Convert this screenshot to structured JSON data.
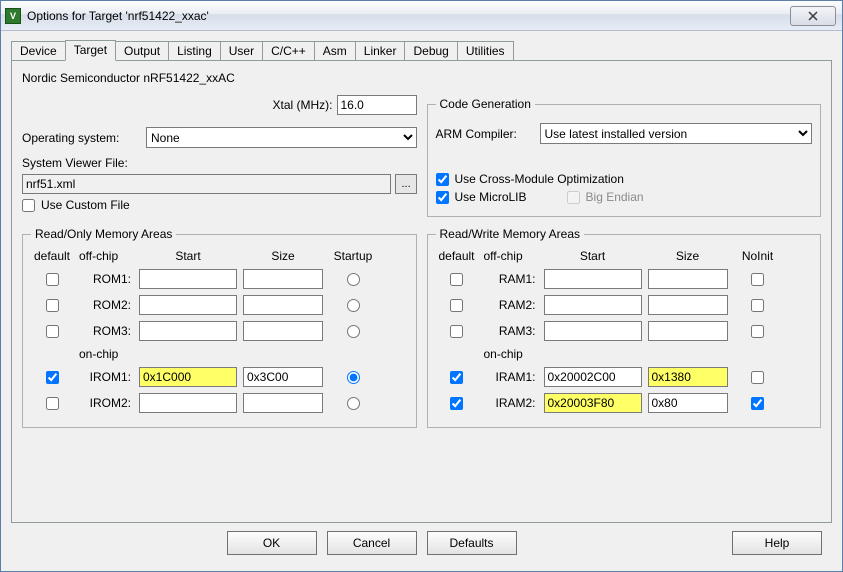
{
  "window": {
    "title": "Options for Target 'nrf51422_xxac'"
  },
  "tabs": [
    "Device",
    "Target",
    "Output",
    "Listing",
    "User",
    "C/C++",
    "Asm",
    "Linker",
    "Debug",
    "Utilities"
  ],
  "active_tab": "Target",
  "chip": "Nordic Semiconductor nRF51422_xxAC",
  "xtal": {
    "label": "Xtal (MHz):",
    "value": "16.0"
  },
  "os_label": "Operating system:",
  "os_value": "None",
  "svf_label": "System Viewer File:",
  "svf_value": "nrf51.xml",
  "svf_browse": "...",
  "custom_file": "Use Custom File",
  "codegen": {
    "title": "Code Generation",
    "compiler_label": "ARM Compiler:",
    "compiler_value": "Use latest installed version",
    "cross_module": "Use Cross-Module Optimization",
    "microlib": "Use MicroLIB",
    "big_endian": "Big Endian"
  },
  "ro": {
    "title": "Read/Only Memory Areas",
    "headers": {
      "def": "default",
      "chip": "off-chip",
      "start": "Start",
      "size": "Size",
      "extra": "Startup"
    },
    "rows": [
      {
        "def": false,
        "name": "ROM1:",
        "start": "",
        "size": "",
        "radio": false
      },
      {
        "def": false,
        "name": "ROM2:",
        "start": "",
        "size": "",
        "radio": false
      },
      {
        "def": false,
        "name": "ROM3:",
        "start": "",
        "size": "",
        "radio": false
      }
    ],
    "onchip_label": "on-chip",
    "onchip": [
      {
        "def": true,
        "name": "IROM1:",
        "start": "0x1C000",
        "size": "0x3C00",
        "radio": true,
        "hl_start": true
      },
      {
        "def": false,
        "name": "IROM2:",
        "start": "",
        "size": "",
        "radio": false
      }
    ]
  },
  "rw": {
    "title": "Read/Write Memory Areas",
    "headers": {
      "def": "default",
      "chip": "off-chip",
      "start": "Start",
      "size": "Size",
      "extra": "NoInit"
    },
    "rows": [
      {
        "def": false,
        "name": "RAM1:",
        "start": "",
        "size": "",
        "noinit": false
      },
      {
        "def": false,
        "name": "RAM2:",
        "start": "",
        "size": "",
        "noinit": false
      },
      {
        "def": false,
        "name": "RAM3:",
        "start": "",
        "size": "",
        "noinit": false
      }
    ],
    "onchip_label": "on-chip",
    "onchip": [
      {
        "def": true,
        "name": "IRAM1:",
        "start": "0x20002C00",
        "size": "0x1380",
        "noinit": false,
        "hl_size": true
      },
      {
        "def": true,
        "name": "IRAM2:",
        "start": "0x20003F80",
        "size": "0x80",
        "noinit": true,
        "hl_start": true
      }
    ]
  },
  "buttons": {
    "ok": "OK",
    "cancel": "Cancel",
    "defaults": "Defaults",
    "help": "Help"
  }
}
